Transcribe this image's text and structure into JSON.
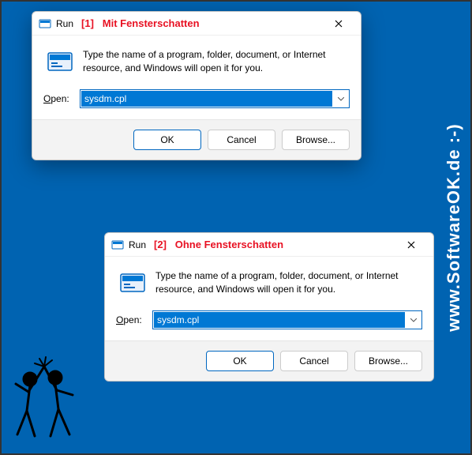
{
  "watermark_side": "www.SoftwareOK.de :-)",
  "watermark_bg": "www.SoftwareOK.de :-)",
  "dialogs": [
    {
      "title": "Run",
      "annotation_num": "[1]",
      "annotation_text": "Mit Fensterschatten",
      "description": "Type the name of a program, folder, document, or Internet resource, and Windows will open it for you.",
      "open_label": "Open:",
      "input_value": "sysdm.cpl",
      "ok": "OK",
      "cancel": "Cancel",
      "browse": "Browse..."
    },
    {
      "title": "Run",
      "annotation_num": "[2]",
      "annotation_text": "Ohne Fensterschatten",
      "description": "Type the name of a program, folder, document, or Internet resource, and Windows will open it for you.",
      "open_label": "Open:",
      "input_value": "sysdm.cpl",
      "ok": "OK",
      "cancel": "Cancel",
      "browse": "Browse..."
    }
  ]
}
